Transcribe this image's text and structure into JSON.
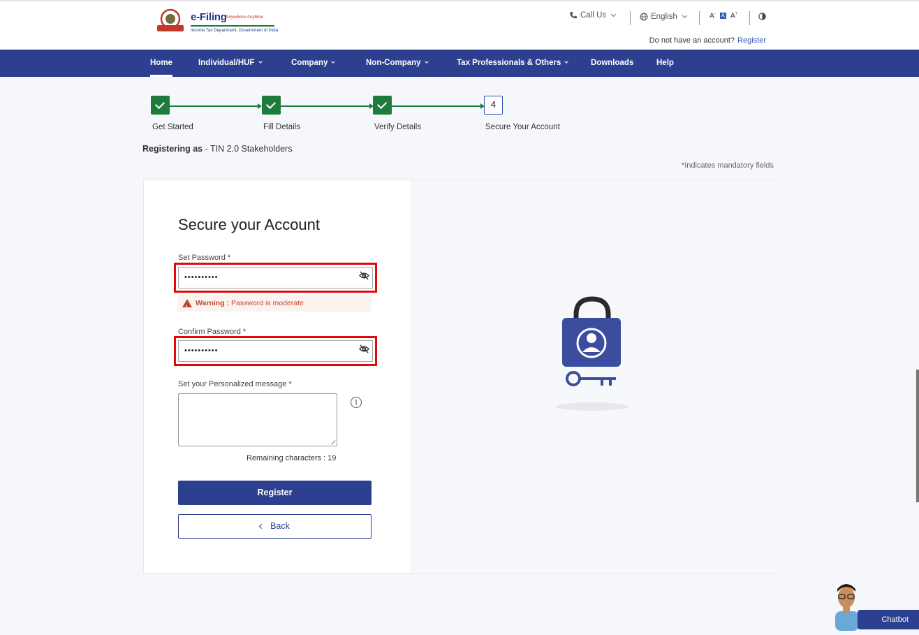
{
  "header": {
    "brand": "e-Filing",
    "tagline": "Anywhere Anytime",
    "department": "Income Tax Department, Government of India",
    "call_us": "Call Us",
    "language": "English",
    "font_small": "A",
    "font_default": "A",
    "font_large": "A",
    "contrast_icon": "contrast-icon",
    "account_prompt": "Do not have an account?",
    "register_link": "Register"
  },
  "nav": {
    "items": [
      {
        "label": "Home",
        "active": true
      },
      {
        "label": "Individual/HUF",
        "dropdown": true
      },
      {
        "label": "Company",
        "dropdown": true
      },
      {
        "label": "Non-Company",
        "dropdown": true
      },
      {
        "label": "Tax Professionals & Others",
        "dropdown": true
      },
      {
        "label": "Downloads"
      },
      {
        "label": "Help"
      }
    ]
  },
  "stepper": {
    "steps": [
      {
        "label": "Get Started",
        "status": "done"
      },
      {
        "label": "Fill Details",
        "status": "done"
      },
      {
        "label": "Verify Details",
        "status": "done"
      },
      {
        "label": "Secure Your Account",
        "status": "current",
        "number": "4"
      }
    ]
  },
  "page": {
    "registering_prefix": "Registering as",
    "registering_value": "- TIN 2.0 Stakeholders",
    "mandatory_note": "*Indicates mandatory fields"
  },
  "form": {
    "title": "Secure your Account",
    "password_label": "Set Password *",
    "password_value": "••••••••••",
    "warning_prefix": "Warning :",
    "warning_text": "Password is moderate",
    "confirm_label": "Confirm Password *",
    "confirm_value": "••••••••••",
    "message_label": "Set your Personalized message *",
    "message_value": "",
    "info_icon": "i",
    "remaining": "Remaining characters : 19",
    "register_button": "Register",
    "back_button": "Back"
  },
  "chatbot": {
    "label": "Chatbot"
  },
  "colors": {
    "primary": "#2d3f8f",
    "success": "#1e7b3b",
    "highlight": "#e10a0a",
    "warning": "#c0472b"
  }
}
